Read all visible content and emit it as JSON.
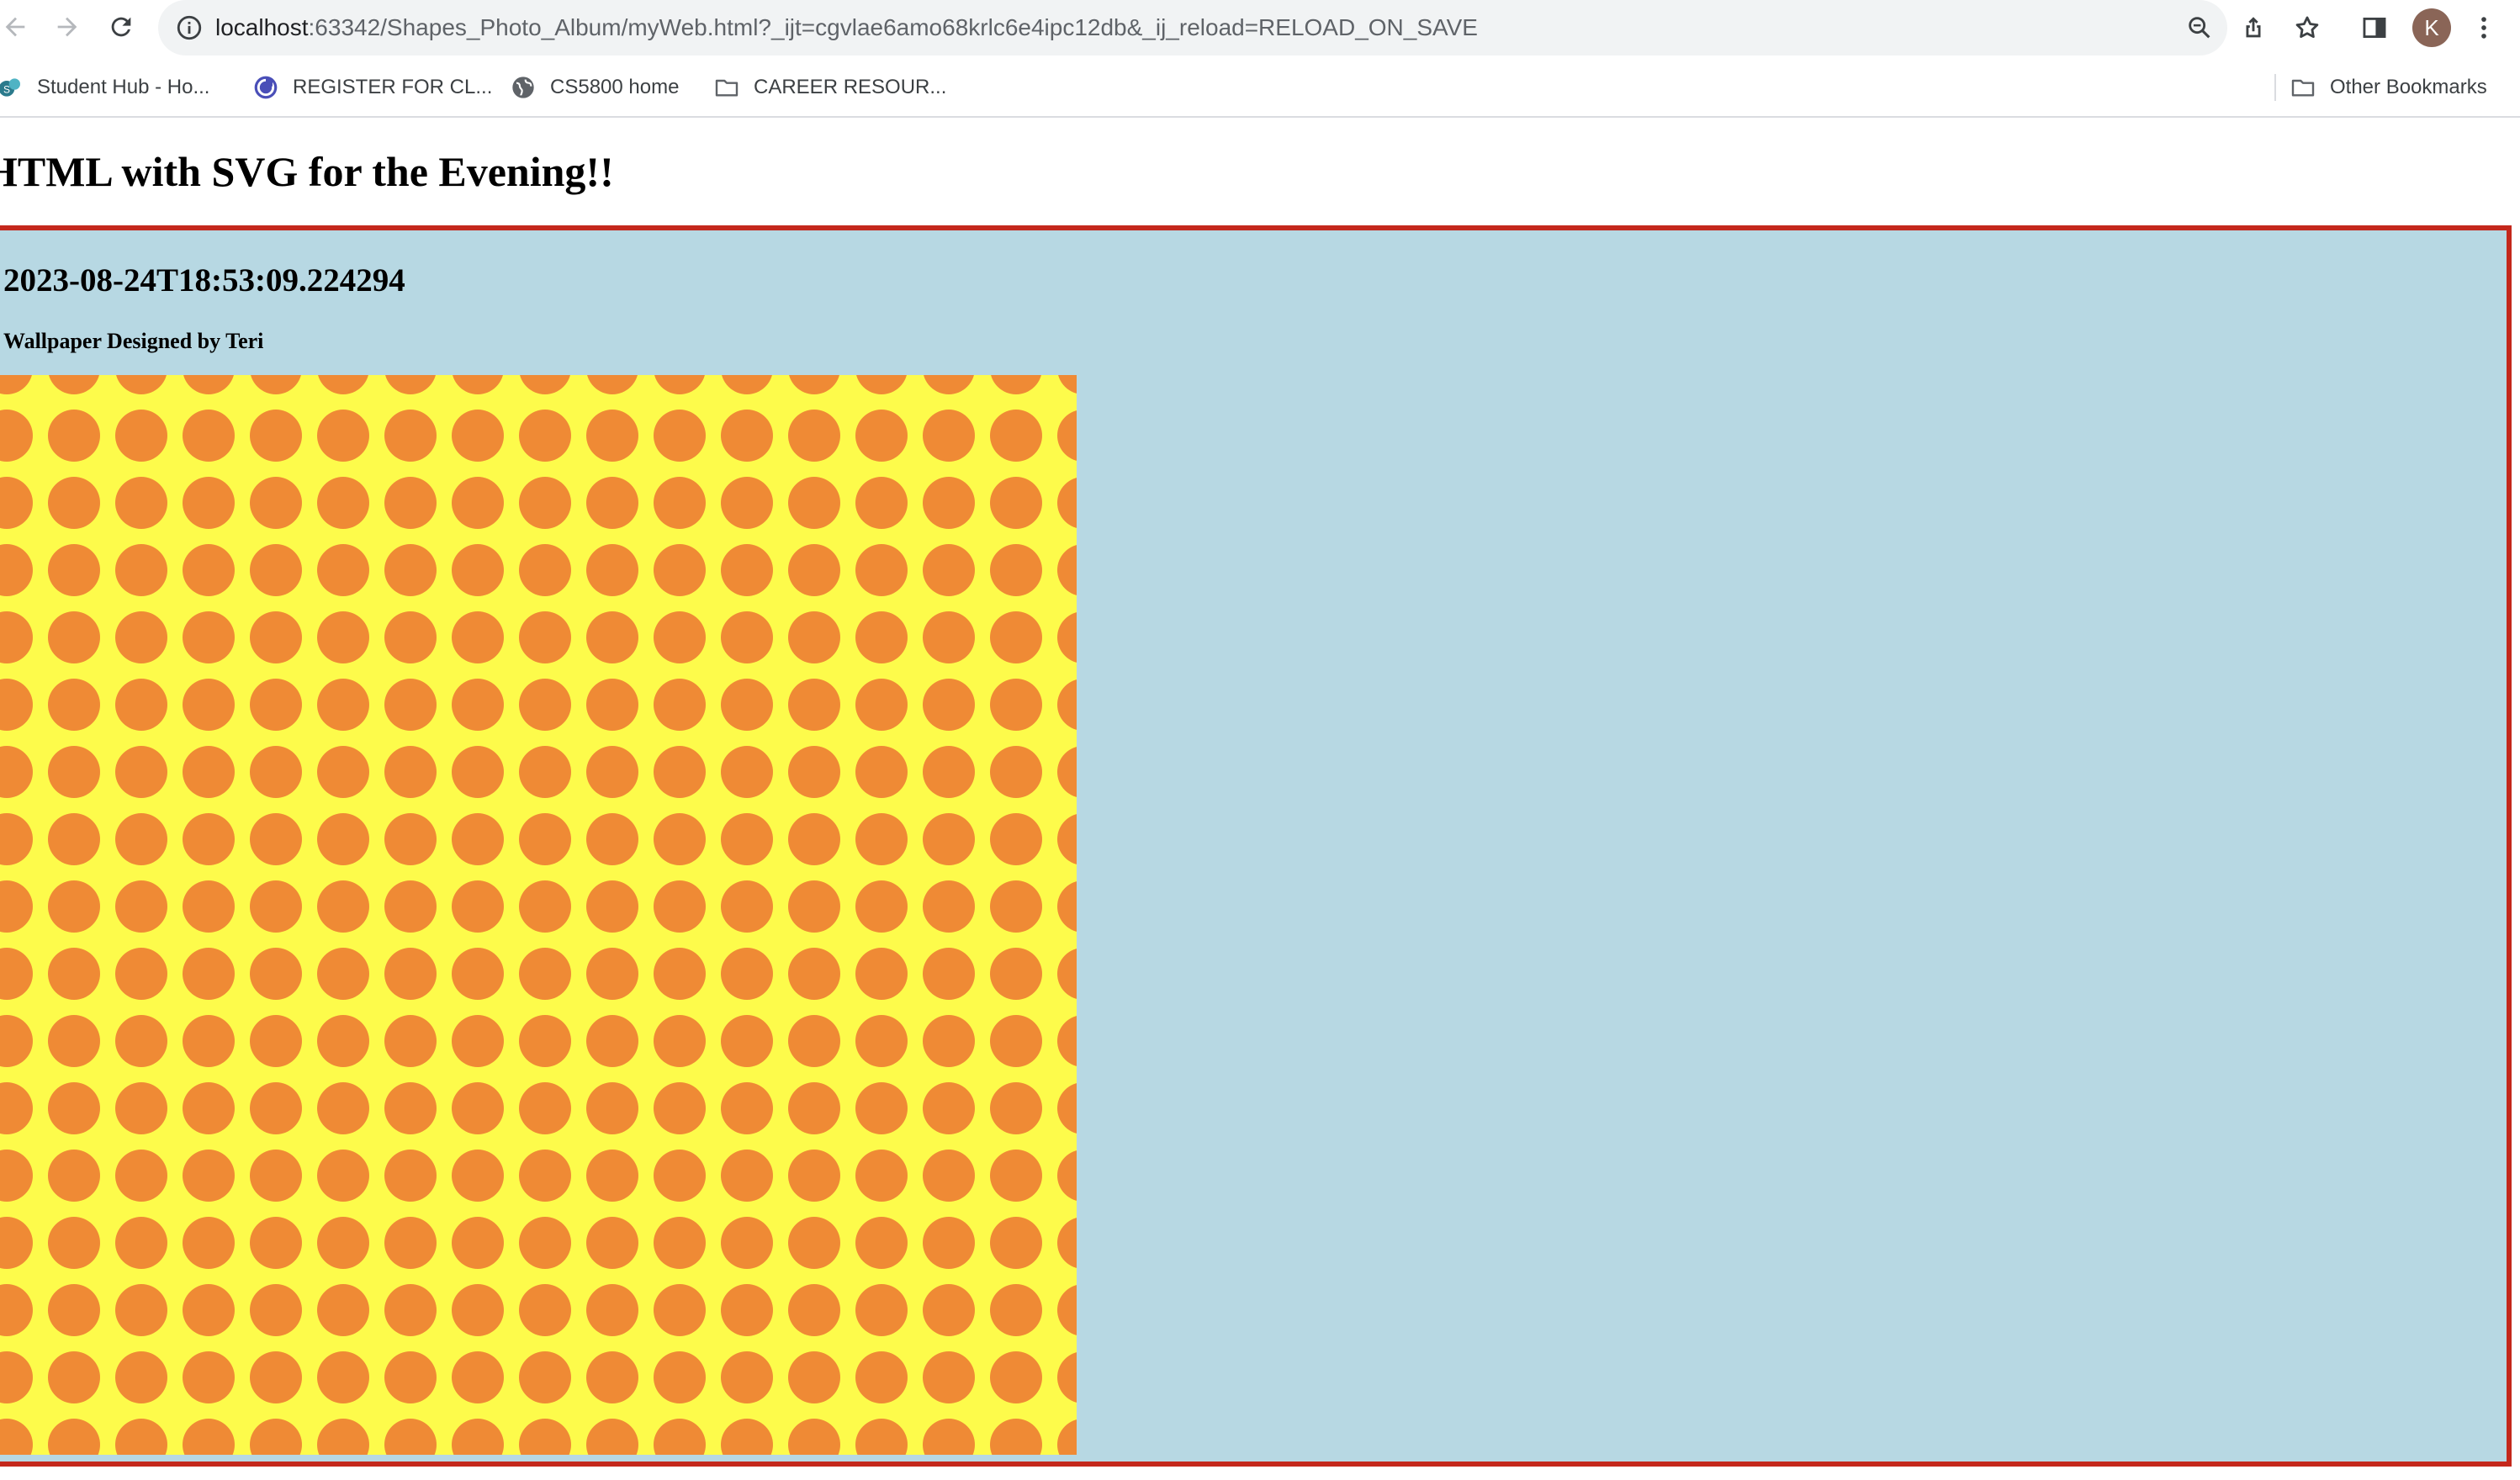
{
  "browser": {
    "url_host": "localhost",
    "url_rest": ":63342/Shapes_Photo_Album/myWeb.html?_ijt=cgvlae6amo68krlc6e4ipc12db&_ij_reload=RELOAD_ON_SAVE",
    "avatar_initial": "K",
    "toolbar_icons": [
      "back-arrow-icon",
      "forward-arrow-icon",
      "reload-icon",
      "site-info-icon",
      "zoom-icon",
      "share-icon",
      "bookmark-star-icon",
      "side-panel-icon",
      "kebab-menu-icon"
    ],
    "bookmarks": [
      {
        "label": "Student Hub - Ho...",
        "icon": "student-hub-icon"
      },
      {
        "label": "REGISTER FOR CL...",
        "icon": "register-icon"
      },
      {
        "label": "CS5800 home",
        "icon": "globe-icon"
      },
      {
        "label": "CAREER RESOUR...",
        "icon": "folder-icon"
      }
    ],
    "other_bookmarks": "Other Bookmarks"
  },
  "page": {
    "heading": "HTML with SVG for the Evening!!",
    "timestamp": "2023-08-24T18:53:09.224294",
    "credit": "Wallpaper Designed by Teri"
  },
  "colors": {
    "frame_background": "#b7d8e3",
    "frame_border": "#c4281c",
    "wallpaper_background": "#fdfb4b",
    "wallpaper_dot": "#ef8a35"
  }
}
